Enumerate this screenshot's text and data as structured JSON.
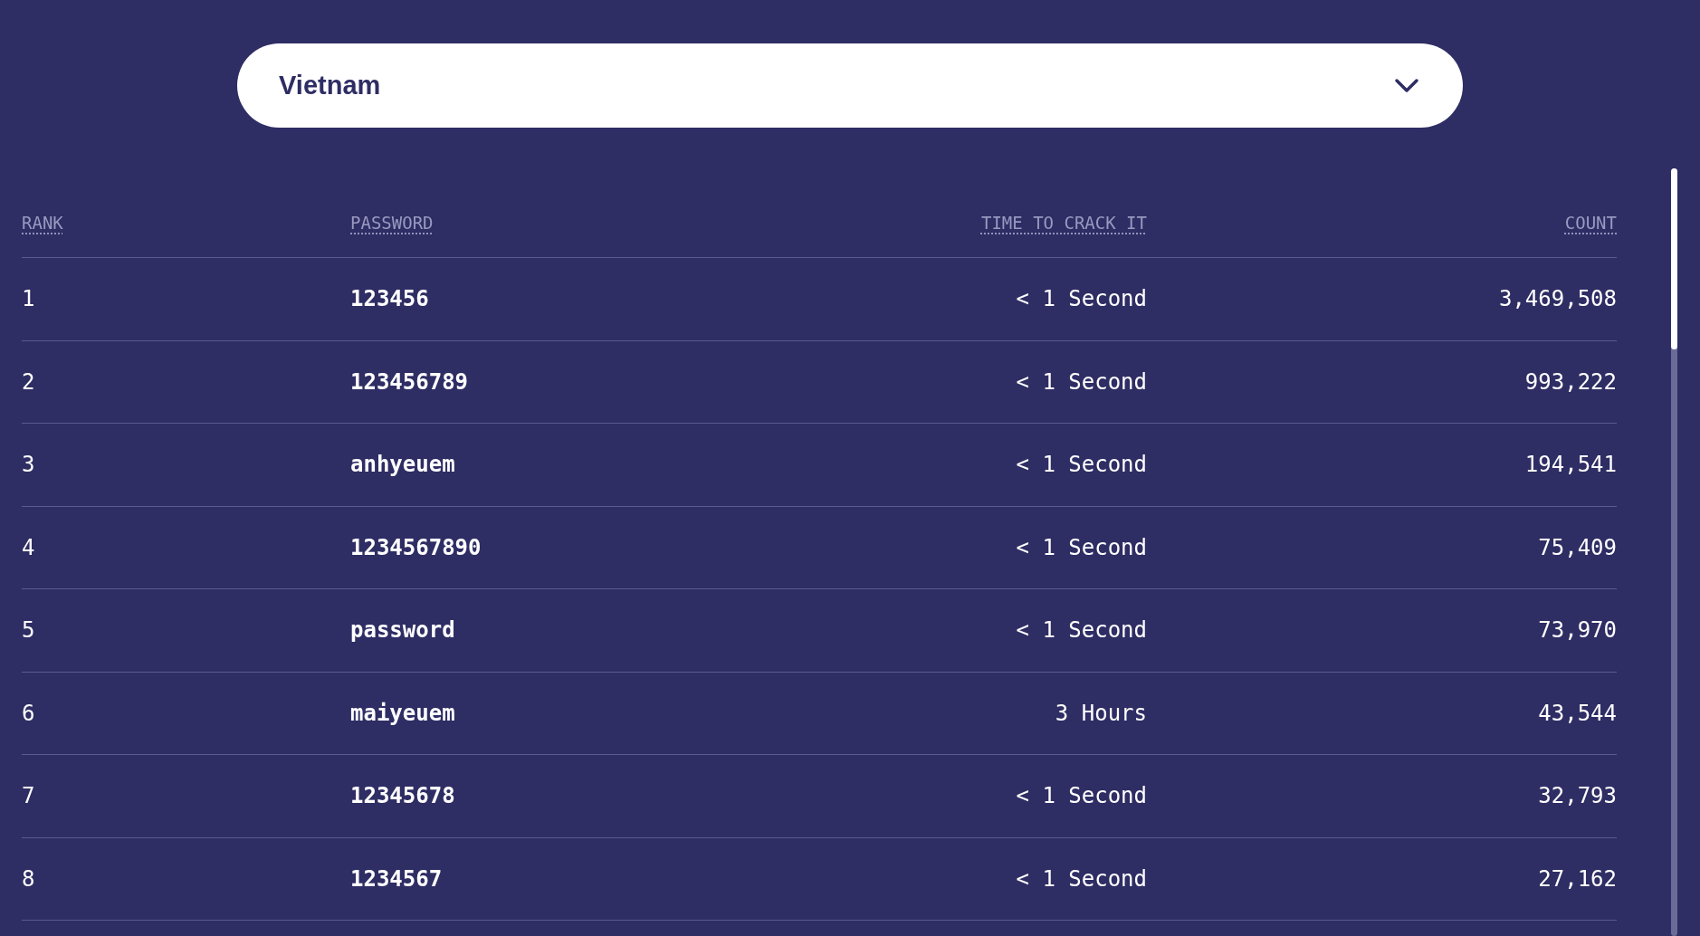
{
  "country_select": {
    "value": "Vietnam"
  },
  "table": {
    "columns": [
      "RANK",
      "PASSWORD",
      "TIME TO CRACK IT",
      "COUNT"
    ],
    "rows": [
      {
        "rank": "1",
        "password": "123456",
        "time": "< 1 Second",
        "count": "3,469,508"
      },
      {
        "rank": "2",
        "password": "123456789",
        "time": "< 1 Second",
        "count": "993,222"
      },
      {
        "rank": "3",
        "password": "anhyeuem",
        "time": "< 1 Second",
        "count": "194,541"
      },
      {
        "rank": "4",
        "password": "1234567890",
        "time": "< 1 Second",
        "count": "75,409"
      },
      {
        "rank": "5",
        "password": "password",
        "time": "< 1 Second",
        "count": "73,970"
      },
      {
        "rank": "6",
        "password": "maiyeuem",
        "time": "3 Hours",
        "count": "43,544"
      },
      {
        "rank": "7",
        "password": "12345678",
        "time": "< 1 Second",
        "count": "32,793"
      },
      {
        "rank": "8",
        "password": "1234567",
        "time": "< 1 Second",
        "count": "27,162"
      }
    ]
  }
}
